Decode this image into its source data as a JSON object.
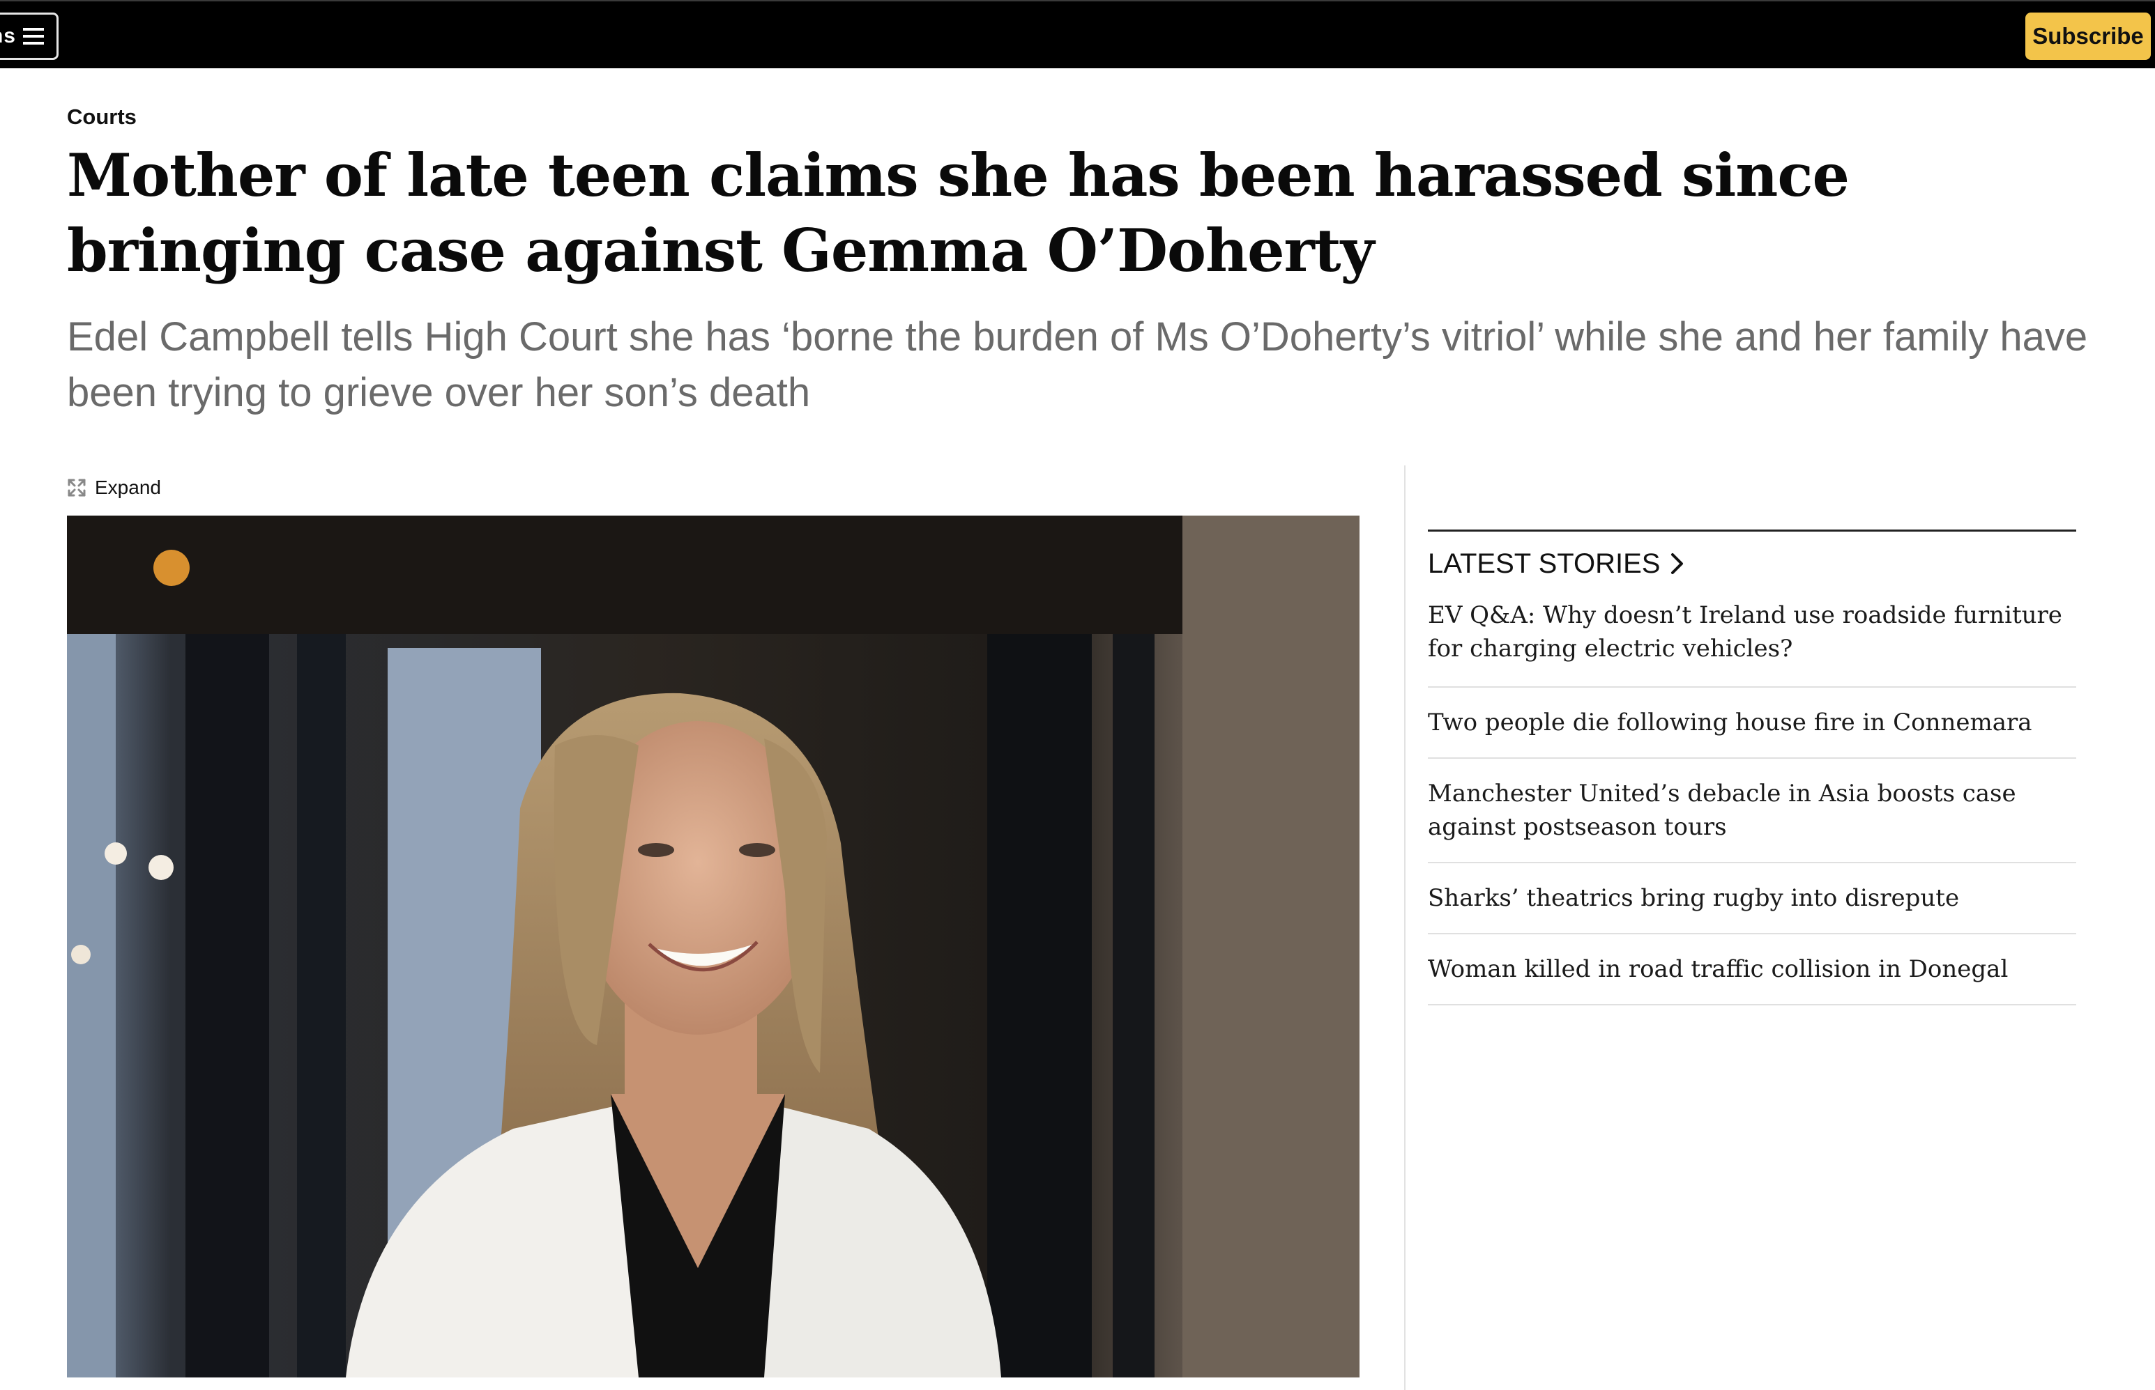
{
  "header": {
    "menu_label": "ns",
    "subscribe_label": "Subscribe"
  },
  "article": {
    "section": "Courts",
    "headline": "Mother of late teen claims she has been harassed since bringing case against Gemma O’Doherty",
    "standfirst": "Edel Campbell tells High Court she has ‘borne the burden of Ms O’Doherty’s vitriol’ while she and her family have been trying to grieve over her son’s death",
    "expand_label": "Expand"
  },
  "sidebar": {
    "title": "LATEST STORIES",
    "stories": [
      "EV Q&A: Why doesn’t Ireland use roadside furniture for charging electric vehicles?",
      "Two people die following house fire in Connemara",
      "Manchester United’s debacle in Asia boosts case against postseason tours",
      "Sharks’ theatrics bring rugby into disrepute",
      "Woman killed in road traffic collision in Donegal"
    ]
  },
  "icons": {
    "menu": "hamburger-icon",
    "expand": "expand-icon",
    "latest": "chevron-right-icon"
  },
  "colors": {
    "topbar": "#000000",
    "subscribe_accent": "#f3c44a",
    "standfirst": "#6a6a6a"
  }
}
